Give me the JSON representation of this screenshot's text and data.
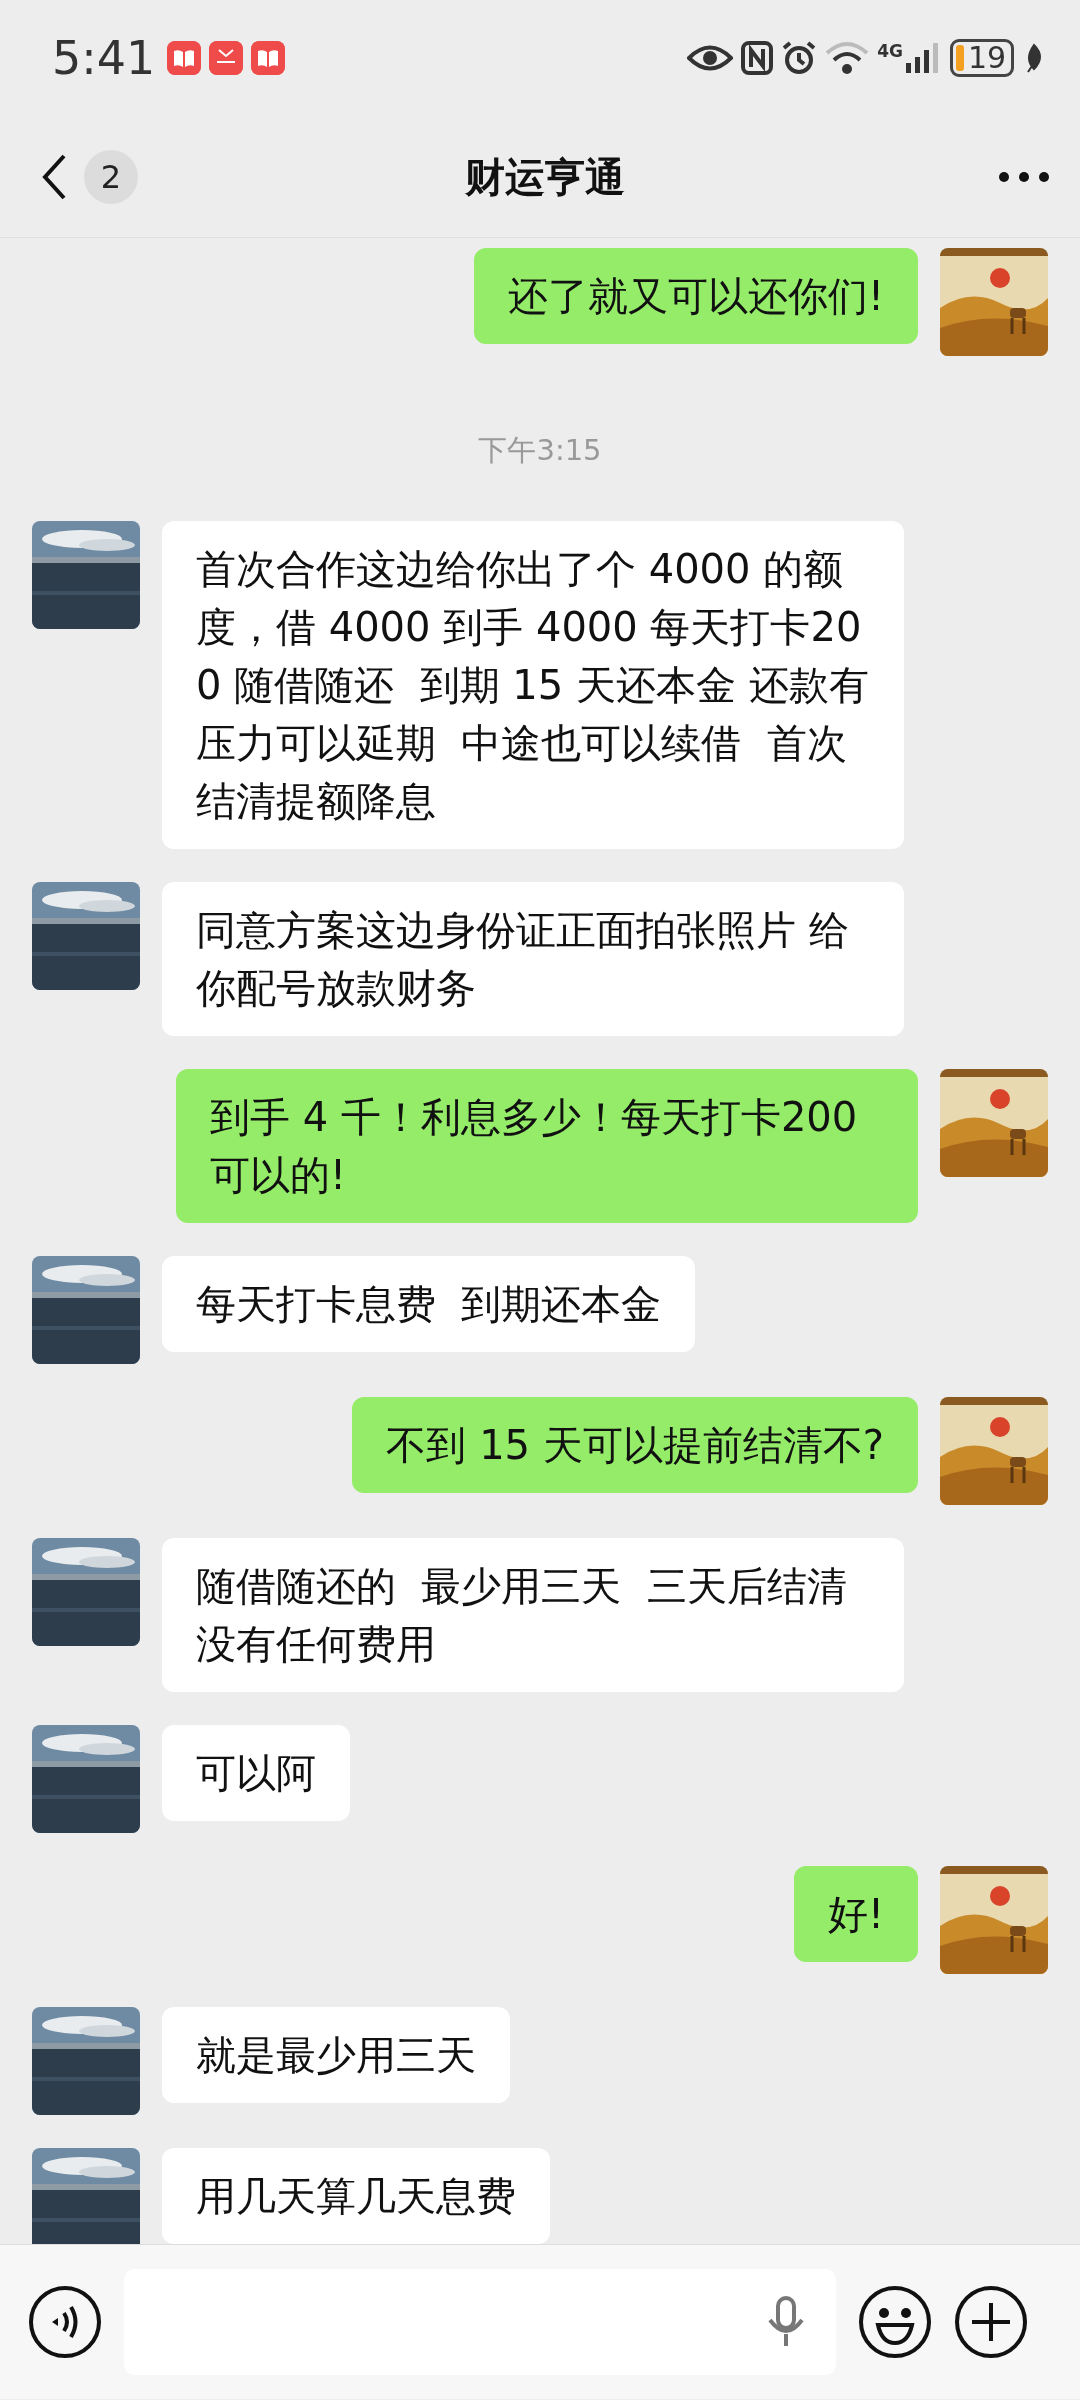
{
  "status_bar": {
    "time": "5:41",
    "network": "4G",
    "battery": "19"
  },
  "header": {
    "back_badge": "2",
    "title": "财运亨通"
  },
  "messages": [
    {
      "kind": "text",
      "outgoing": true,
      "text": "还了就又可以还你们!"
    },
    {
      "kind": "time",
      "text": "下午3:15"
    },
    {
      "kind": "text",
      "outgoing": false,
      "text": "首次合作这边给你出了个 4000 的额度，借 4000 到手 4000 每天打卡200 随借随还  到期 15 天还本金 还款有压力可以延期  中途也可以续借  首次结清提额降息"
    },
    {
      "kind": "text",
      "outgoing": false,
      "text": "同意方案这边身份证正面拍张照片 给你配号放款财务"
    },
    {
      "kind": "text",
      "outgoing": true,
      "text": "到手 4 千！利息多少！每天打卡200 可以的!"
    },
    {
      "kind": "text",
      "outgoing": false,
      "text": "每天打卡息费  到期还本金"
    },
    {
      "kind": "text",
      "outgoing": true,
      "text": "不到 15 天可以提前结清不?"
    },
    {
      "kind": "text",
      "outgoing": false,
      "text": "随借随还的  最少用三天  三天后结清没有任何费用"
    },
    {
      "kind": "text",
      "outgoing": false,
      "text": "可以阿"
    },
    {
      "kind": "text",
      "outgoing": true,
      "text": "好!"
    },
    {
      "kind": "text",
      "outgoing": false,
      "text": "就是最少用三天"
    },
    {
      "kind": "text",
      "outgoing": false,
      "text": "用几天算几天息费"
    }
  ]
}
